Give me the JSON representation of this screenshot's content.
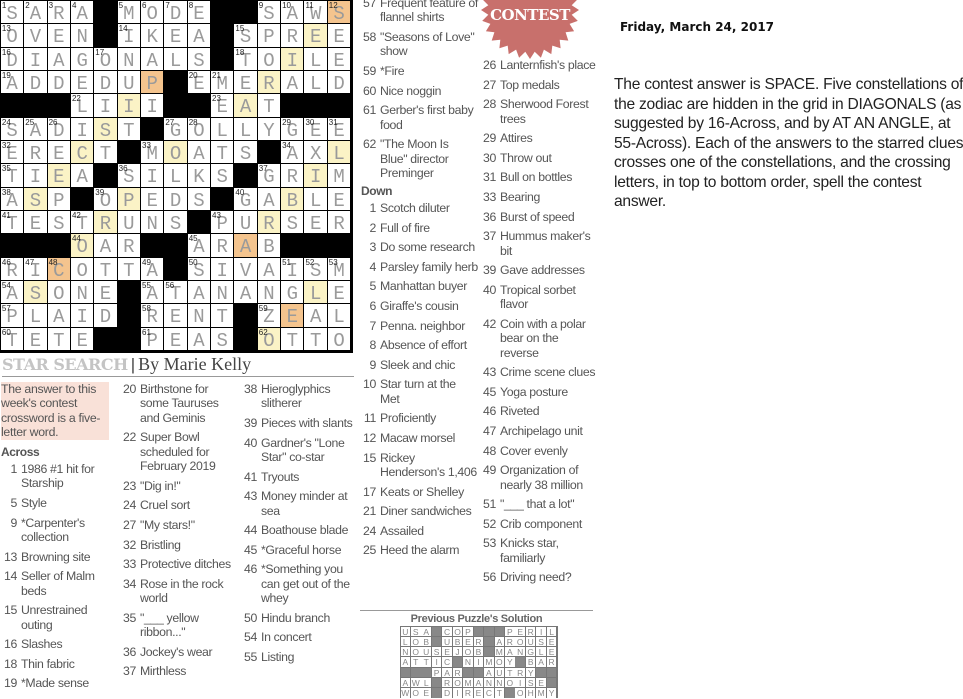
{
  "grid": {
    "rows": [
      "SARA#MODE##SAWS",
      "OVEN#IKEA#SPREE",
      "DIAGONALS#TOILE",
      "ADDEDUP#EMERALD",
      "###LIII##EAT###",
      "SADIST#GOLLYGEE",
      "ERECT#MOATS#AXL",
      "TIEA#SILKS#GRIM",
      "ASP#OPEDS#GABLE",
      "TESTRUNS#PURSER",
      "###OAR##ARAB###",
      "RICOTTA#SIVAISM",
      "ASONE#ATANANGLE",
      "PLAID#RENT#ZEAL",
      "TETE##PEAS#OTTO"
    ],
    "highlights": [
      "..............o",
      ".............y.",
      "............y..",
      "......o....y...",
      ".....y....y....",
      "....y..........",
      "...y...y......y",
      "..y..........y.",
      ".y...y......y..",
      "....y......y...",
      "...y......o....",
      "..o............",
      ".y...........y.",
      "............o..",
      "...........y..."
    ],
    "numbers": [
      [
        [
          0,
          1
        ],
        [
          1,
          2
        ],
        [
          2,
          3
        ],
        [
          3,
          4
        ],
        [
          5,
          5
        ],
        [
          6,
          6
        ],
        [
          7,
          7
        ],
        [
          8,
          8
        ],
        [
          11,
          9
        ],
        [
          12,
          10
        ],
        [
          13,
          11
        ],
        [
          14,
          12
        ]
      ],
      [
        [
          0,
          13
        ],
        [
          5,
          14
        ],
        [
          10,
          15
        ]
      ],
      [
        [
          0,
          16
        ],
        [
          4,
          17
        ],
        [
          10,
          18
        ]
      ],
      [
        [
          0,
          19
        ],
        [
          8,
          20
        ],
        [
          9,
          21
        ]
      ],
      [
        [
          3,
          22
        ],
        [
          9,
          23
        ]
      ],
      [
        [
          0,
          24
        ],
        [
          1,
          25
        ],
        [
          2,
          26
        ],
        [
          7,
          27
        ],
        [
          8,
          28
        ],
        [
          12,
          29
        ],
        [
          13,
          30
        ],
        [
          14,
          31
        ]
      ],
      [
        [
          0,
          32
        ],
        [
          6,
          33
        ],
        [
          12,
          34
        ]
      ],
      [
        [
          0,
          35
        ],
        [
          5,
          36
        ],
        [
          11,
          37
        ]
      ],
      [
        [
          0,
          38
        ],
        [
          4,
          39
        ],
        [
          10,
          40
        ]
      ],
      [
        [
          0,
          41
        ],
        [
          3,
          42
        ],
        [
          9,
          43
        ]
      ],
      [
        [
          3,
          44
        ],
        [
          8,
          45
        ]
      ],
      [
        [
          0,
          46
        ],
        [
          1,
          47
        ],
        [
          2,
          48
        ],
        [
          6,
          49
        ],
        [
          8,
          50
        ],
        [
          12,
          51
        ],
        [
          13,
          52
        ],
        [
          14,
          53
        ]
      ],
      [
        [
          0,
          54
        ],
        [
          6,
          55
        ],
        [
          7,
          56
        ]
      ],
      [
        [
          0,
          57
        ],
        [
          6,
          58
        ],
        [
          11,
          59
        ]
      ],
      [
        [
          0,
          60
        ],
        [
          6,
          61
        ],
        [
          11,
          62
        ]
      ]
    ],
    "highlight_colors": {
      "y": "#fbf3c6",
      "o": "#f4c48e"
    }
  },
  "title": {
    "name": "STAR SEARCH",
    "separator": "|",
    "byline": "By Marie Kelly"
  },
  "info_box": "The answer to this week's contest crossword is a five-letter word.",
  "across_label": "Across",
  "down_label": "Down",
  "columns": [
    [
      {
        "n": "1",
        "t": "1986 #1 hit for Starship"
      },
      {
        "n": "5",
        "t": "Style"
      },
      {
        "n": "9",
        "t": "*Carpenter's collection"
      },
      {
        "n": "13",
        "t": "Browning site"
      },
      {
        "n": "14",
        "t": "Seller of Malm beds"
      },
      {
        "n": "15",
        "t": "Unrestrained outing"
      },
      {
        "n": "16",
        "t": "Slashes"
      },
      {
        "n": "18",
        "t": "Thin fabric"
      },
      {
        "n": "19",
        "t": "*Made sense"
      }
    ],
    [
      {
        "n": "20",
        "t": "Birthstone for some Tauruses and Geminis"
      },
      {
        "n": "22",
        "t": "Super Bowl scheduled for February 2019"
      },
      {
        "n": "23",
        "t": "\"Dig in!\""
      },
      {
        "n": "24",
        "t": "Cruel sort"
      },
      {
        "n": "27",
        "t": "\"My stars!\""
      },
      {
        "n": "32",
        "t": "Bristling"
      },
      {
        "n": "33",
        "t": "Protective ditches"
      },
      {
        "n": "34",
        "t": "Rose in the rock world"
      },
      {
        "n": "35",
        "t": "\"___ yellow ribbon...\""
      },
      {
        "n": "36",
        "t": "Jockey's wear"
      },
      {
        "n": "37",
        "t": "Mirthless"
      }
    ],
    [
      {
        "n": "38",
        "t": "Hieroglyphics slitherer"
      },
      {
        "n": "39",
        "t": "Pieces with slants"
      },
      {
        "n": "40",
        "t": "Gardner's \"Lone Star\" co-star"
      },
      {
        "n": "41",
        "t": "Tryouts"
      },
      {
        "n": "43",
        "t": "Money minder at sea"
      },
      {
        "n": "44",
        "t": "Boathouse blade"
      },
      {
        "n": "45",
        "t": "*Graceful horse"
      },
      {
        "n": "46",
        "t": "*Something you can get out of the whey"
      },
      {
        "n": "50",
        "t": "Hindu branch"
      },
      {
        "n": "54",
        "t": "In concert"
      },
      {
        "n": "55",
        "t": "Listing"
      }
    ],
    [
      {
        "n": "57",
        "t": "Frequent feature of flannel shirts"
      },
      {
        "n": "58",
        "t": "\"Seasons of Love\" show"
      },
      {
        "n": "59",
        "t": "*Fire"
      },
      {
        "n": "60",
        "t": "Nice noggin"
      },
      {
        "n": "61",
        "t": "Gerber's first baby food"
      },
      {
        "n": "62",
        "t": "\"The Moon Is Blue\" director Preminger"
      }
    ],
    [
      {
        "n": "1",
        "t": "Scotch diluter"
      },
      {
        "n": "2",
        "t": "Full of fire"
      },
      {
        "n": "3",
        "t": "Do some research"
      },
      {
        "n": "4",
        "t": "Parsley family herb"
      },
      {
        "n": "5",
        "t": "Manhattan buyer"
      },
      {
        "n": "6",
        "t": "Giraffe's cousin"
      },
      {
        "n": "7",
        "t": "Penna. neighbor"
      },
      {
        "n": "8",
        "t": "Absence of effort"
      },
      {
        "n": "9",
        "t": "Sleek and chic"
      },
      {
        "n": "10",
        "t": "Star turn at the Met"
      },
      {
        "n": "11",
        "t": "Proficiently"
      },
      {
        "n": "12",
        "t": "Macaw morsel"
      },
      {
        "n": "15",
        "t": "Rickey Henderson's 1,406"
      },
      {
        "n": "17",
        "t": "Keats or Shelley"
      },
      {
        "n": "21",
        "t": "Diner sandwiches"
      },
      {
        "n": "24",
        "t": "Assailed"
      },
      {
        "n": "25",
        "t": "Heed the alarm"
      }
    ],
    [
      {
        "n": "26",
        "t": "Lanternfish's place"
      },
      {
        "n": "27",
        "t": "Top medals"
      },
      {
        "n": "28",
        "t": "Sherwood Forest trees"
      },
      {
        "n": "29",
        "t": "Attires"
      },
      {
        "n": "30",
        "t": "Throw out"
      },
      {
        "n": "31",
        "t": "Bull on bottles"
      },
      {
        "n": "33",
        "t": "Bearing"
      },
      {
        "n": "36",
        "t": "Burst of speed"
      },
      {
        "n": "37",
        "t": "Hummus maker's bit"
      },
      {
        "n": "39",
        "t": "Gave addresses"
      },
      {
        "n": "40",
        "t": "Tropical sorbet flavor"
      },
      {
        "n": "42",
        "t": "Coin with a polar bear on the reverse"
      },
      {
        "n": "43",
        "t": "Crime scene clues"
      },
      {
        "n": "45",
        "t": "Yoga posture"
      },
      {
        "n": "46",
        "t": "Riveted"
      },
      {
        "n": "47",
        "t": "Archipelago unit"
      },
      {
        "n": "48",
        "t": "Cover evenly"
      },
      {
        "n": "49",
        "t": "Organization of nearly 38 million"
      },
      {
        "n": "51",
        "t": "\"___ that a lot\""
      },
      {
        "n": "52",
        "t": "Crib component"
      },
      {
        "n": "53",
        "t": "Knicks star, familiarly"
      },
      {
        "n": "56",
        "t": "Driving need?"
      }
    ]
  ],
  "previous_solution": {
    "title": "Previous Puzzle's Solution",
    "rows": [
      "USA#COP###PERIL",
      "LOB#UBER#AROUSE",
      "NOUSEJOB#MANGLE",
      "ATTIC#NIMOY#BAR",
      "###PAR##AUTRY##",
      "AWL#ROMANNOISE#",
      "WOE#DIRECT#OHMY"
    ]
  },
  "badge": {
    "label": "CONTEST",
    "color": "#c8706c"
  },
  "date": "Friday, March 24, 2017",
  "note": "The contest answer is SPACE. Five constellations of the zodiac are hidden in the grid in DIAGONALS (as suggested by 16-Across, and by AT AN ANGLE, at 55-Across). Each of the answers to the starred clues crosses one of the constellations, and the crossing letters, in top to bottom order, spell the contest answer."
}
